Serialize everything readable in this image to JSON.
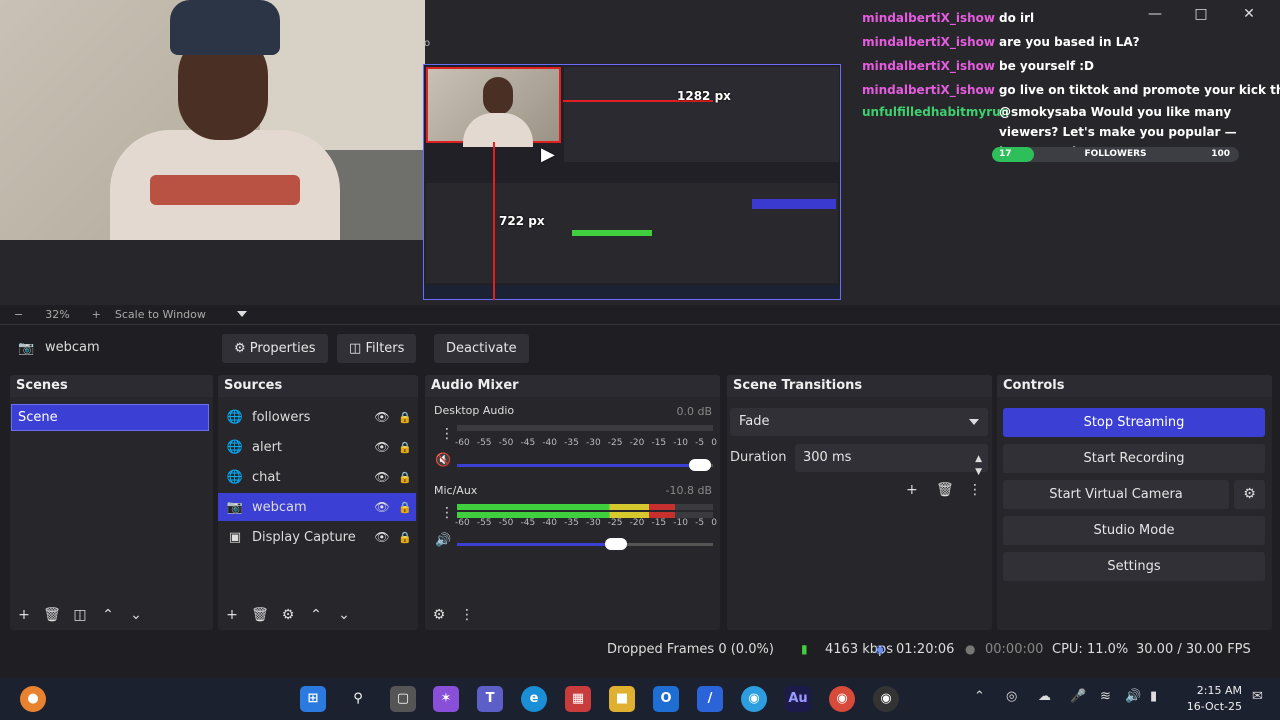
{
  "window": {
    "minimize_icon": "minimize-icon",
    "maximize_icon": "maximize-icon",
    "close_icon": "close-icon"
  },
  "preview": {
    "measure_width": "1282 px",
    "measure_height": "722 px",
    "small_marker": "o"
  },
  "chat": {
    "lines": [
      {
        "user": "mindalbertiX_ishow",
        "msg": "do irl"
      },
      {
        "user": "mindalbertiX_ishow",
        "msg": "are you based in LA?"
      },
      {
        "user": "mindalbertiX_ishow",
        "msg": "be yourself :D"
      },
      {
        "user": "mindalbertiX_ishow",
        "msg": "go live on tiktok and promote your kick there?"
      }
    ],
    "multi": {
      "user": "unfulfilledhabitmyrun",
      "msg": "@smokysaba Would you like many viewers? Let's make you popular — https://nezhna.com"
    },
    "followers": {
      "current": "17",
      "goal": "100",
      "label": "FOLLOWERS",
      "progress": 0.17
    }
  },
  "zoombar": {
    "minus": "−",
    "zoom": "32%",
    "plus": "+",
    "mode": "Scale to Window"
  },
  "source_toolbar": {
    "source_name": "webcam",
    "properties": "Properties",
    "filters": "Filters",
    "deactivate": "Deactivate"
  },
  "scenes": {
    "title": "Scenes",
    "items": [
      "Scene"
    ]
  },
  "sources": {
    "title": "Sources",
    "items": [
      {
        "label": "followers",
        "icon": "globe-icon"
      },
      {
        "label": "alert",
        "icon": "globe-icon"
      },
      {
        "label": "chat",
        "icon": "globe-icon"
      },
      {
        "label": "webcam",
        "icon": "camera-icon"
      },
      {
        "label": "Display Capture",
        "icon": "monitor-icon"
      }
    ]
  },
  "audio_mixer": {
    "title": "Audio Mixer",
    "channels": [
      {
        "name": "Desktop Audio",
        "db": "0.0 dB",
        "level": 0.0,
        "volume": 0.95
      },
      {
        "name": "Mic/Aux",
        "db": "-10.8 dB",
        "level": 0.85,
        "volume": 0.62
      }
    ],
    "scale": [
      "-60",
      "-55",
      "-50",
      "-45",
      "-40",
      "-35",
      "-30",
      "-25",
      "-20",
      "-15",
      "-10",
      "-5",
      "0"
    ]
  },
  "scene_transitions": {
    "title": "Scene Transitions",
    "selected": "Fade",
    "duration_label": "Duration",
    "duration_value": "300 ms"
  },
  "controls": {
    "title": "Controls",
    "stop_streaming": "Stop Streaming",
    "start_recording": "Start Recording",
    "start_virtual_camera": "Start Virtual Camera",
    "studio_mode": "Studio Mode",
    "settings": "Settings"
  },
  "status": {
    "dropped": "Dropped Frames 0 (0.0%)",
    "bitrate": "4163 kbps",
    "stream_time": "01:20:06",
    "rec_time": "00:00:00",
    "cpu": "CPU: 11.0%",
    "fps": "30.00 / 30.00 FPS"
  },
  "taskbar": {
    "time": "2:15 AM",
    "date": "16-Oct-25"
  },
  "colors": {
    "accent": "#3b3fd3",
    "chat_user": "#e55dde",
    "chat_user_alt": "#3fcf6e",
    "meter_green": "#3fcf3f",
    "meter_yellow": "#d6c92d",
    "meter_red": "#c83030"
  }
}
